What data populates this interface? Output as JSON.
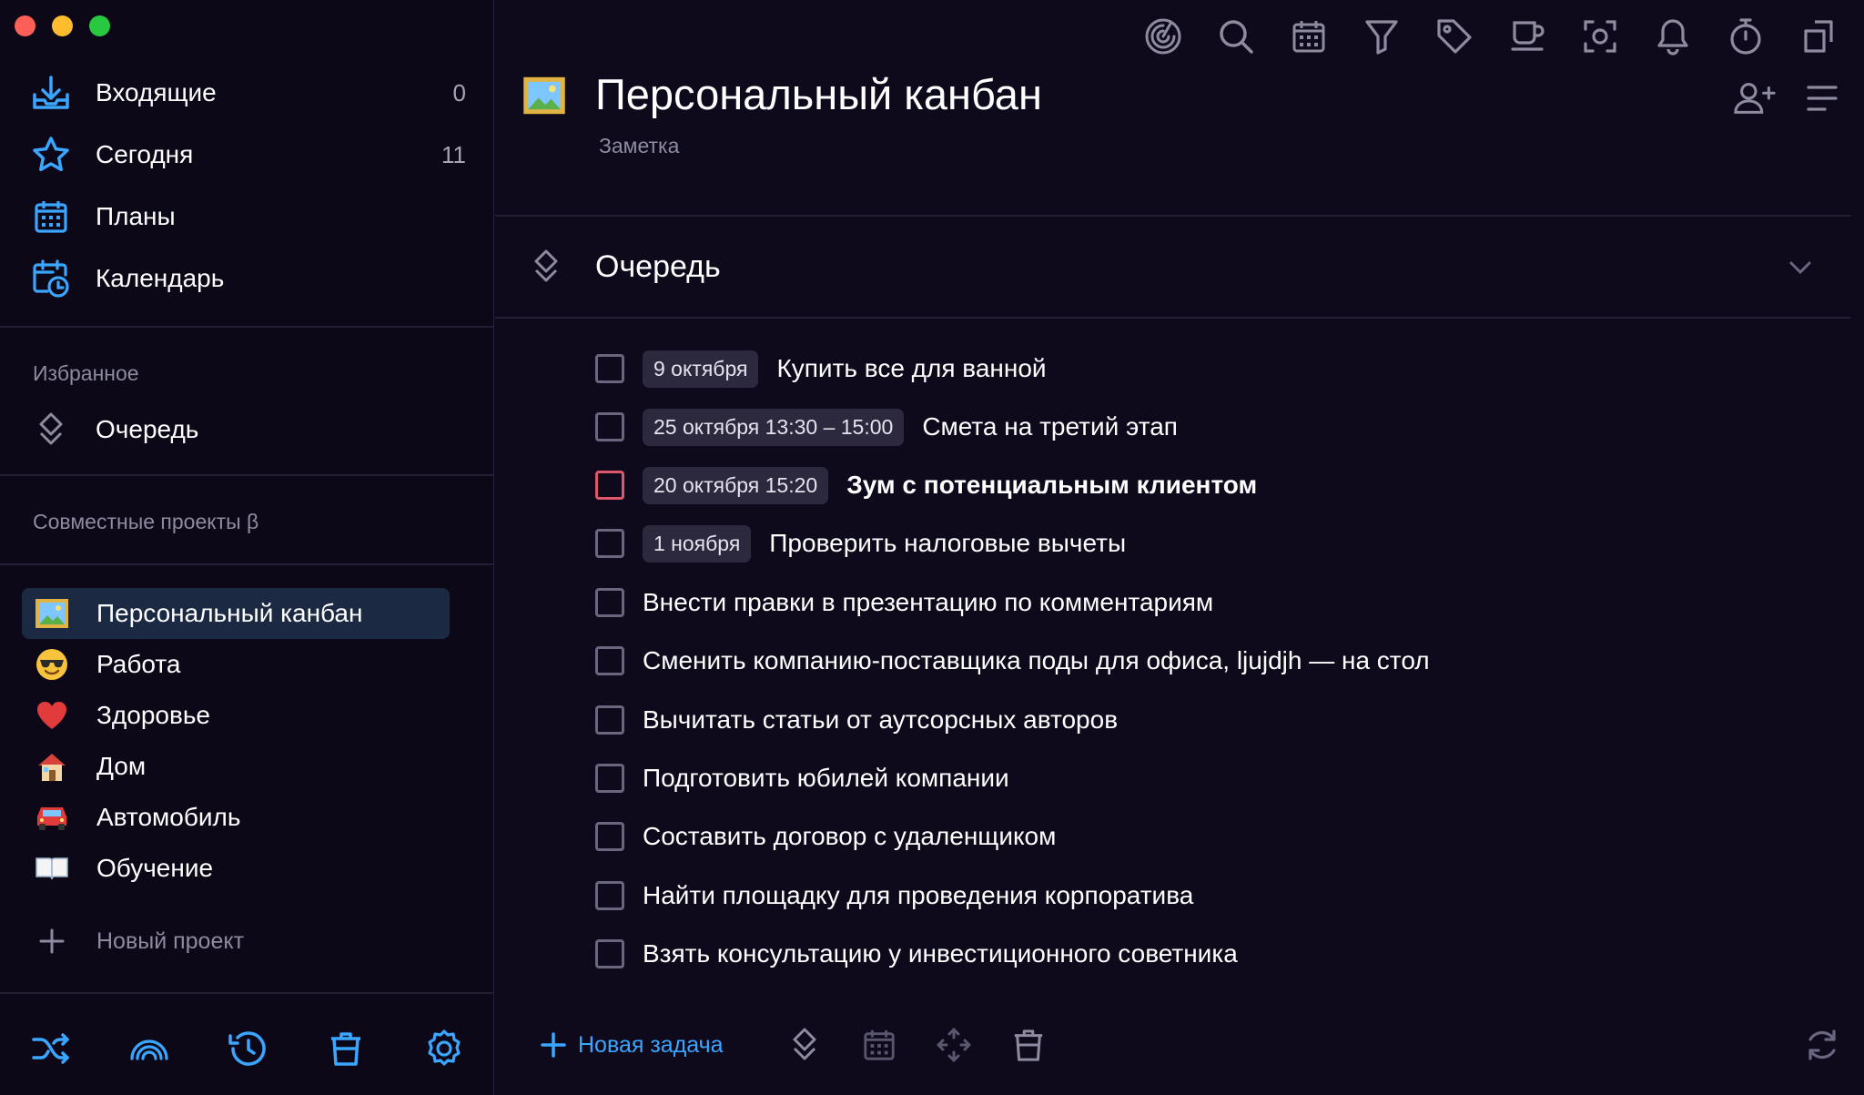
{
  "window": {
    "traffic_lights": [
      "#ff5f57",
      "#febc2e",
      "#28c840"
    ]
  },
  "colors": {
    "accent": "#3aa6ff",
    "danger": "#e0566a",
    "active_bg": "#1c2942"
  },
  "sidebar": {
    "nav": [
      {
        "label": "Входящие",
        "count": "0",
        "icon": "inbox-icon"
      },
      {
        "label": "Сегодня",
        "count": "11",
        "icon": "star-icon"
      },
      {
        "label": "Планы",
        "count": "",
        "icon": "calendar-grid-icon"
      },
      {
        "label": "Календарь",
        "count": "",
        "icon": "calendar-clock-icon"
      }
    ],
    "favorites_title": "Избранное",
    "favorites": [
      {
        "label": "Очередь",
        "icon": "queue-icon"
      }
    ],
    "shared_title": "Совместные проекты β",
    "projects": [
      {
        "label": "Персональный канбан",
        "icon": "picture-icon",
        "active": true
      },
      {
        "label": "Работа",
        "icon": "sunglasses-emoji-icon"
      },
      {
        "label": "Здоровье",
        "icon": "heart-icon"
      },
      {
        "label": "Дом",
        "icon": "house-icon"
      },
      {
        "label": "Автомобиль",
        "icon": "car-icon"
      },
      {
        "label": "Обучение",
        "icon": "book-icon"
      }
    ],
    "new_project": "Новый проект",
    "bottom_icons": [
      "shuffle-icon",
      "rainbow-icon",
      "history-icon",
      "trash-icon",
      "settings-icon"
    ]
  },
  "toolbar": {
    "icons": [
      "focus-icon",
      "search-icon",
      "calendar-icon",
      "filter-icon",
      "tag-icon",
      "coffee-icon",
      "screenshot-icon",
      "bell-icon",
      "timer-icon",
      "export-icon"
    ]
  },
  "page": {
    "title": "Персональный канбан",
    "subtitle": "Заметка",
    "section": "Очередь"
  },
  "tasks": [
    {
      "date": "9 октября",
      "title": "Купить все для ванной"
    },
    {
      "date": "25 октября 13:30 – 15:00",
      "title": "Смета на третий этап"
    },
    {
      "date": "20 октября 15:20",
      "title": "Зум с потенциальным клиентом",
      "bold": true,
      "red": true
    },
    {
      "date": "1 ноября",
      "title": "Проверить налоговые вычеты"
    },
    {
      "date": "",
      "title": "Внести правки в презентацию по комментариям"
    },
    {
      "date": "",
      "title": "Сменить компанию-поставщика поды для офиса, ljujdjh — на стол"
    },
    {
      "date": "",
      "title": "Вычитать статьи от аутсорсных авторов"
    },
    {
      "date": "",
      "title": "Подготовить юбилей компании"
    },
    {
      "date": "",
      "title": "Составить договор с удаленщиком"
    },
    {
      "date": "",
      "title": "Найти площадку для проведения корпоратива"
    },
    {
      "date": "",
      "title": "Взять консультацию у инвестиционного советника"
    }
  ],
  "bottom_bar": {
    "new_task": "Новая задача"
  }
}
